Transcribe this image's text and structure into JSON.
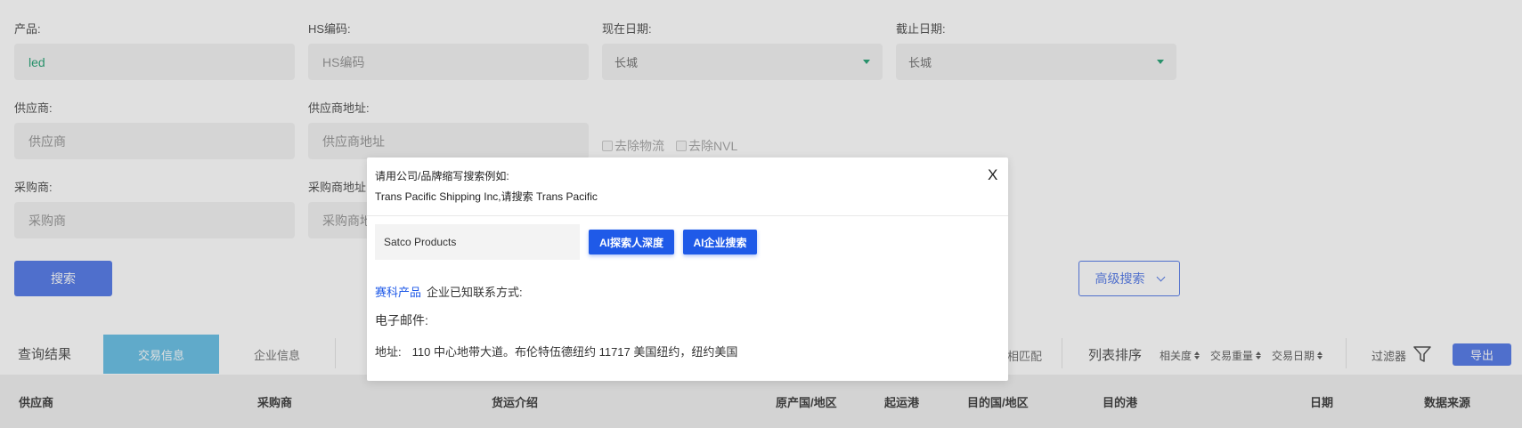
{
  "form": {
    "product": {
      "label": "产品:",
      "value": "led"
    },
    "hs_code": {
      "label": "HS编码:",
      "placeholder": "HS编码"
    },
    "current_date": {
      "label": "现在日期:",
      "value": "长城"
    },
    "end_date": {
      "label": "截止日期:",
      "value": "长城"
    },
    "supplier": {
      "label": "供应商:",
      "placeholder": "供应商"
    },
    "supplier_address": {
      "label": "供应商地址:",
      "placeholder": "供应商地址"
    },
    "exclude_logistics": "去除物流",
    "exclude_nvl": "去除NVL",
    "buyer": {
      "label": "采购商:",
      "placeholder": "采购商"
    },
    "buyer_address": {
      "label": "采购商地址:",
      "placeholder": "采购商地址"
    },
    "search_button": "搜索",
    "advanced_search_button": "高级搜索"
  },
  "results": {
    "label": "查询结果",
    "tabs": [
      {
        "label": "交易信息",
        "active": true
      },
      {
        "label": "企业信息",
        "active": false
      }
    ],
    "match_text": "相匹配",
    "sort_label": "列表排序",
    "sort_options": [
      "相关度",
      "交易重量",
      "交易日期"
    ],
    "filter_label": "过滤器",
    "export_button": "导出",
    "columns": [
      "供应商",
      "采购商",
      "货运介绍",
      "原产国/地区",
      "起运港",
      "目的国/地区",
      "目的港",
      "日期",
      "数据来源"
    ]
  },
  "modal": {
    "hint_line1": "请用公司/品牌缩写搜索例如:",
    "hint_line2": "Trans Pacific Shipping Inc,请搜索 Trans Pacific",
    "close": "X",
    "search_value": "Satco Products",
    "ai_deep_button": "AI探索人深度",
    "ai_company_button": "AI企业搜索",
    "company_name": "赛科产品",
    "company_suffix": "企业已知联系方式:",
    "email_label": "电子邮件:",
    "address_label": "地址:",
    "address_value": "110 中心地带大道。布伦特伍德纽约 11717 美国纽约，纽约美国"
  },
  "colors": {
    "primary": "#5b7fe9",
    "active_tab": "#6ec2e6",
    "accent_green": "#2fa67a",
    "modal_button": "#1f5ae8"
  }
}
